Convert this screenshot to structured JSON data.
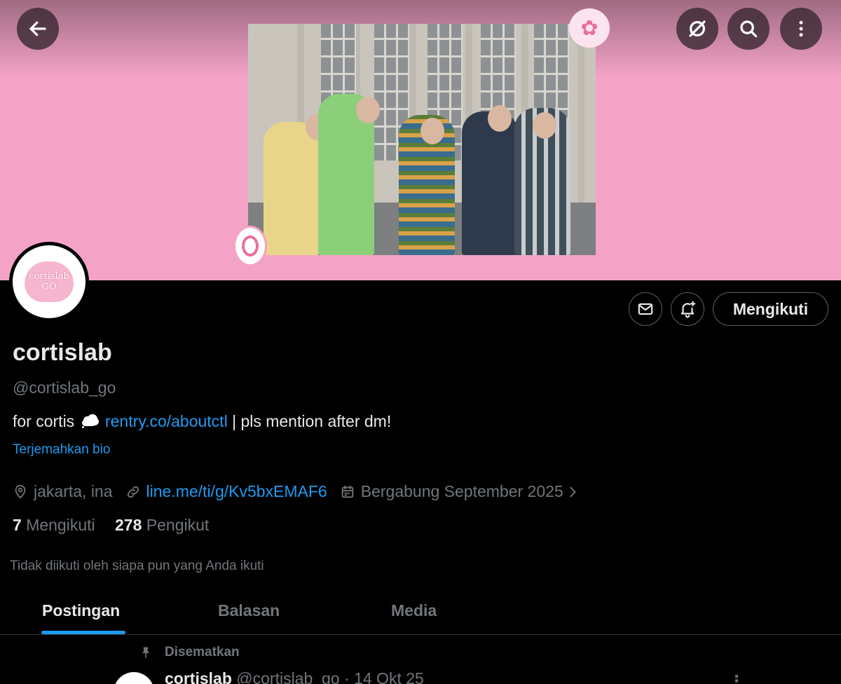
{
  "header": {
    "back_icon": "arrow-left-icon",
    "grok_icon": "grok-icon",
    "search_icon": "search-icon",
    "more_icon": "more-vertical-icon"
  },
  "profile": {
    "display_name": "cortislab",
    "handle": "@cortislab_go",
    "avatar_text_line1": "cortislab",
    "avatar_text_line2": "GO",
    "bio_prefix": "for cortis",
    "bio_link": "rentry.co/aboutctl",
    "bio_suffix": "| pls mention after dm!",
    "translate_bio": "Terjemahkan bio",
    "location": "jakarta, ina",
    "website": "line.me/ti/g/Kv5bxEMAF6",
    "joined": "Bergabung September 2025",
    "following_count": "7",
    "following_label": "Mengikuti",
    "followers_count": "278",
    "followers_label": "Pengikut",
    "followed_by_note": "Tidak diikuti oleh siapa pun yang Anda ikuti"
  },
  "actions": {
    "message_icon": "envelope-icon",
    "notify_icon": "bell-plus-icon",
    "follow_label": "Mengikuti"
  },
  "tabs": [
    {
      "label": "Postingan",
      "active": true
    },
    {
      "label": "Balasan",
      "active": false
    },
    {
      "label": "Media",
      "active": false
    }
  ],
  "pinned_post": {
    "pinned_label": "Disematkan",
    "author": "cortislab",
    "handle": "@cortislab_go",
    "date": "· 14 Okt 25"
  },
  "colors": {
    "banner": "#f4a3c6",
    "accent": "#1d9bf0",
    "muted": "#71767b",
    "text": "#e7e9ea"
  }
}
